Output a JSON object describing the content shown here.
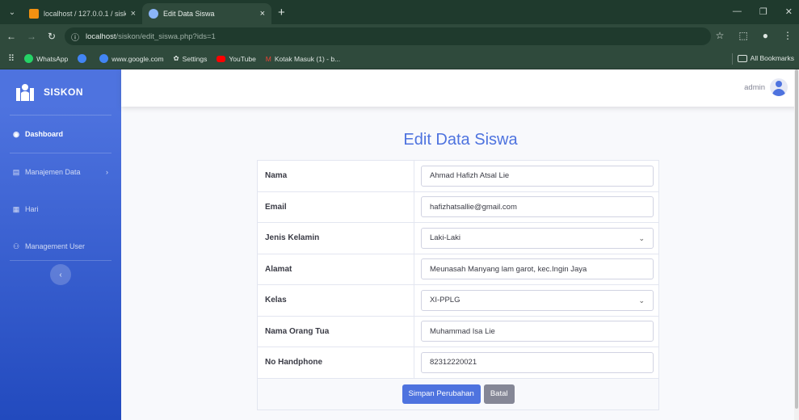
{
  "browser": {
    "tabs": [
      {
        "title": "localhost / 127.0.0.1 / siskon | p",
        "close": "×"
      },
      {
        "title": "Edit Data Siswa",
        "close": "×"
      }
    ],
    "new_tab": "+",
    "url_host": "localhost",
    "url_path": "/siskon/edit_siswa.php?ids=1",
    "bookmarks": [
      {
        "label": "WhatsApp",
        "color": "#25d366"
      },
      {
        "label": "",
        "color": "#4285f4"
      },
      {
        "label": "www.google.com",
        "color": "#4285f4"
      },
      {
        "label": "Settings",
        "color": "#dfe6e2"
      },
      {
        "label": "YouTube",
        "color": "#ff0000"
      },
      {
        "label": "Kotak Masuk (1) - b...",
        "color": "#ea4335"
      }
    ],
    "all_bookmarks": "All Bookmarks"
  },
  "sidebar": {
    "brand": "SISKON",
    "items": [
      {
        "label": "Dashboard",
        "icon": "dashboard-icon"
      },
      {
        "label": "Manajemen Data",
        "icon": "table-icon"
      },
      {
        "label": "Hari",
        "icon": "calendar-icon"
      },
      {
        "label": "Management User",
        "icon": "users-icon"
      }
    ],
    "toggle": "‹"
  },
  "topbar": {
    "user": "admin"
  },
  "form": {
    "title": "Edit Data Siswa",
    "fields": [
      {
        "label": "Nama",
        "value": "Ahmad Hafizh Atsal Lie"
      },
      {
        "label": "Email",
        "value": "hafizhatsallie@gmail.com"
      },
      {
        "label": "Jenis Kelamin",
        "value": "Laki-Laki"
      },
      {
        "label": "Alamat",
        "value": "Meunasah Manyang lam garot, kec.Ingin Jaya"
      },
      {
        "label": "Kelas",
        "value": "XI-PPLG"
      },
      {
        "label": "Nama Orang Tua",
        "value": "Muhammad Isa Lie"
      },
      {
        "label": "No Handphone",
        "value": "82312220021"
      }
    ],
    "save_label": "Simpan Perubahan",
    "cancel_label": "Batal"
  },
  "colors": {
    "primary": "#4e73df",
    "secondary": "#858796",
    "sidebar_dark": "#224abe"
  }
}
